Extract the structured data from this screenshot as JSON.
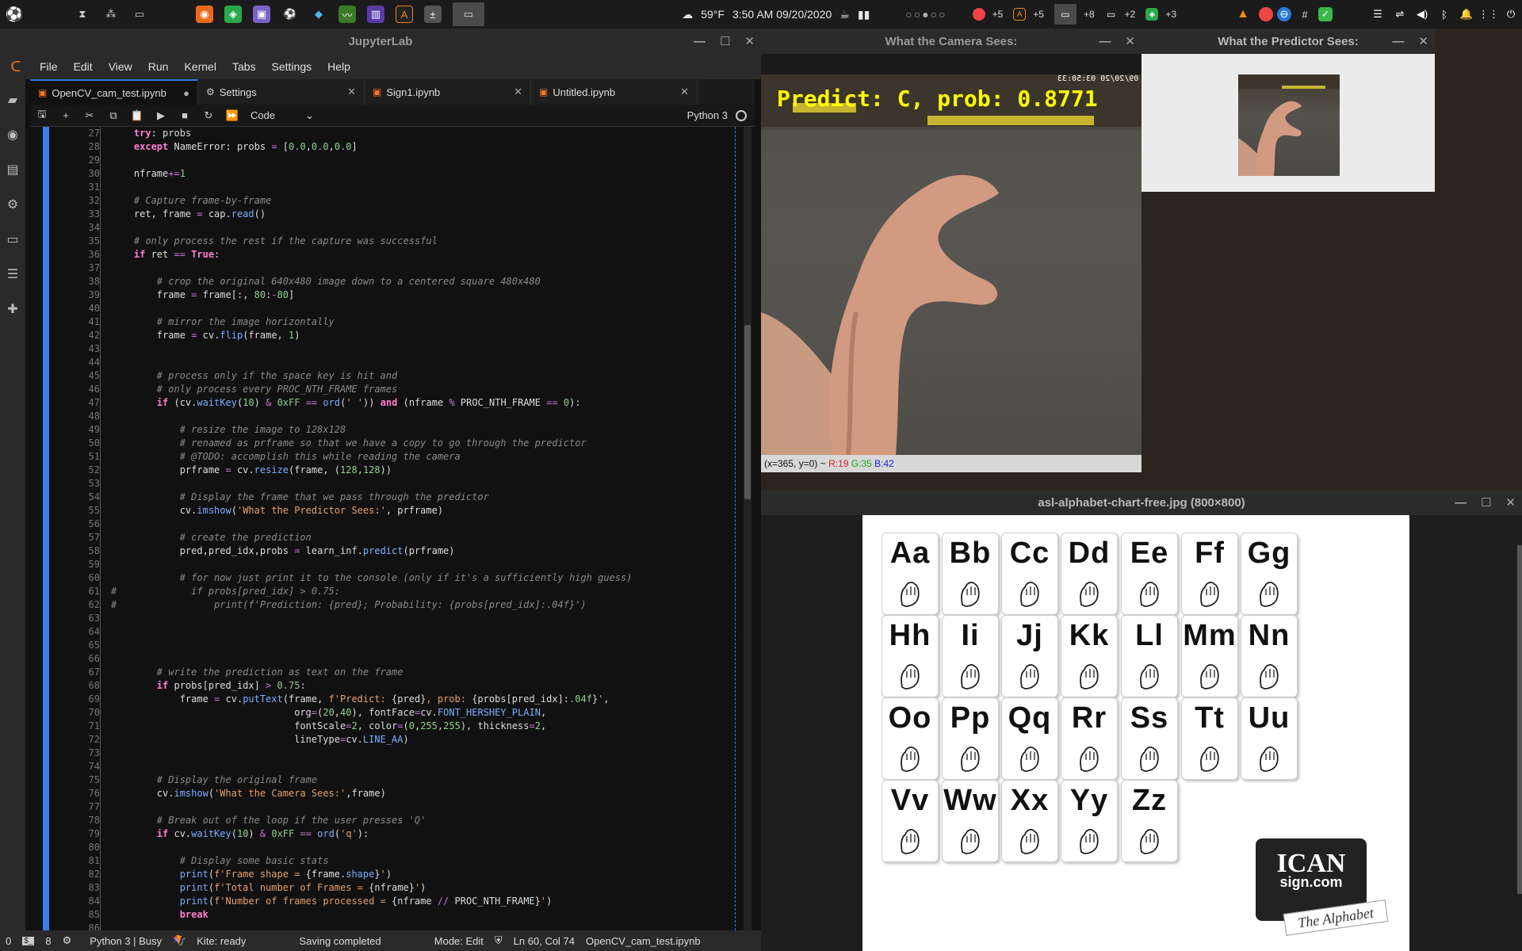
{
  "taskbar": {
    "weather": "59°F",
    "clock": "3:50 AM 09/20/2020",
    "workspaces": "○○●○○",
    "counts": [
      "+5",
      "+5",
      "+8",
      "+2",
      "+3"
    ]
  },
  "jupyter": {
    "title": "JupyterLab",
    "menu": [
      "File",
      "Edit",
      "View",
      "Run",
      "Kernel",
      "Tabs",
      "Settings",
      "Help"
    ],
    "tabs": [
      {
        "label": "OpenCV_cam_test.ipynb"
      },
      {
        "label": "Settings"
      },
      {
        "label": "Sign1.ipynb"
      },
      {
        "label": "Untitled.ipynb"
      }
    ],
    "celltype": "Code",
    "kernel": "Python 3",
    "code_lines": [
      {
        "n": "27",
        "html": "    <span class='t-kw'>try</span>: probs"
      },
      {
        "n": "28",
        "html": "    <span class='t-kw'>except</span> NameError: probs <span class='t-op'>=</span> [<span class='t-nm'>0.0</span>,<span class='t-nm'>0.0</span>,<span class='t-nm'>0.0</span>]"
      },
      {
        "n": "29",
        "html": ""
      },
      {
        "n": "30",
        "html": "    nframe<span class='t-op'>+=</span><span class='t-nm'>1</span>"
      },
      {
        "n": "31",
        "html": ""
      },
      {
        "n": "32",
        "html": "    <span class='t-cm'># Capture frame-by-frame</span>"
      },
      {
        "n": "33",
        "html": "    ret, frame <span class='t-op'>=</span> cap.<span class='t-fn'>read</span>()"
      },
      {
        "n": "34",
        "html": ""
      },
      {
        "n": "35",
        "html": "    <span class='t-cm'># only process the rest if the capture was successful</span>"
      },
      {
        "n": "36",
        "html": "    <span class='t-kw'>if</span> ret <span class='t-op'>==</span> <span class='t-kw'>True</span>:"
      },
      {
        "n": "37",
        "html": ""
      },
      {
        "n": "38",
        "html": "        <span class='t-cm'># crop the original 640x480 image down to a centered square 480x480</span>"
      },
      {
        "n": "39",
        "html": "        frame <span class='t-op'>=</span> frame[:, <span class='t-nm'>80</span>:<span class='t-op'>-</span><span class='t-nm'>80</span>]"
      },
      {
        "n": "40",
        "html": ""
      },
      {
        "n": "41",
        "html": "        <span class='t-cm'># mirror the image horizontally</span>"
      },
      {
        "n": "42",
        "html": "        frame <span class='t-op'>=</span> cv.<span class='t-fn'>flip</span>(frame, <span class='t-nm'>1</span>)"
      },
      {
        "n": "43",
        "html": ""
      },
      {
        "n": "44",
        "html": ""
      },
      {
        "n": "45",
        "html": "        <span class='t-cm'># process only if the space key is hit and</span>"
      },
      {
        "n": "46",
        "html": "        <span class='t-cm'># only process every PROC_NTH_FRAME frames</span>"
      },
      {
        "n": "47",
        "html": "        <span class='t-kw'>if</span> (cv.<span class='t-fn'>waitKey</span>(<span class='t-nm'>10</span>) <span class='t-op'>&amp;</span> <span class='t-nm'>0xFF</span> <span class='t-op'>==</span> <span class='t-fn'>ord</span>(<span class='t-st'>' '</span>)) <span class='t-kw'>and</span> (nframe <span class='t-op'>%</span> PROC_NTH_FRAME <span class='t-op'>==</span> <span class='t-nm'>0</span>):"
      },
      {
        "n": "48",
        "html": ""
      },
      {
        "n": "49",
        "html": "            <span class='t-cm'># resize the image to 128x128</span>"
      },
      {
        "n": "50",
        "html": "            <span class='t-cm'># renamed as prframe so that we have a copy to go through the predictor</span>"
      },
      {
        "n": "51",
        "html": "            <span class='t-cm'># @TODO: accomplish this while reading the camera</span>"
      },
      {
        "n": "52",
        "html": "            prframe <span class='t-op'>=</span> cv.<span class='t-fn'>resize</span>(frame, (<span class='t-nm'>128</span>,<span class='t-nm'>128</span>))"
      },
      {
        "n": "53",
        "html": ""
      },
      {
        "n": "54",
        "html": "            <span class='t-cm'># Display the frame that we pass through the predictor</span>"
      },
      {
        "n": "55",
        "html": "            cv.<span class='t-fn'>imshow</span>(<span class='t-st'>'What the Predictor Sees:'</span>, prframe)"
      },
      {
        "n": "56",
        "html": ""
      },
      {
        "n": "57",
        "html": "            <span class='t-cm'># create the prediction</span>"
      },
      {
        "n": "58",
        "html": "            pred,pred_idx,probs <span class='t-op'>=</span> learn_inf.<span class='t-fn'>predict</span>(prframe)"
      },
      {
        "n": "59",
        "html": ""
      },
      {
        "n": "60",
        "html": "            <span class='t-cm'># for now just print it to the console (only if it's a sufficiently high guess)</span>"
      },
      {
        "n": "61",
        "html": "<span class='t-cm'>#             if probs[pred_idx] &gt; 0.75:</span>"
      },
      {
        "n": "62",
        "html": "<span class='t-cm'>#                 print(f'Prediction: {pred}; Probability: {probs[pred_idx]:.04f}')</span>"
      },
      {
        "n": "63",
        "html": ""
      },
      {
        "n": "64",
        "html": ""
      },
      {
        "n": "65",
        "html": ""
      },
      {
        "n": "66",
        "html": ""
      },
      {
        "n": "67",
        "html": "        <span class='t-cm'># write the prediction as text on the frame</span>"
      },
      {
        "n": "68",
        "html": "        <span class='t-kw'>if</span> probs[pred_idx] <span class='t-op'>&gt;</span> <span class='t-nm'>0.75</span>:"
      },
      {
        "n": "69",
        "html": "            frame <span class='t-op'>=</span> cv.<span class='t-fn'>putText</span>(frame, <span class='t-st'>f'Predict: </span>{pred}<span class='t-st'>, prob: </span>{probs[pred_idx]:<span class='t-nm'>.04f</span>}<span class='t-st'>'</span>,"
      },
      {
        "n": "70",
        "html": "                                org<span class='t-op'>=</span>(<span class='t-nm'>20</span>,<span class='t-nm'>40</span>), fontFace<span class='t-op'>=</span>cv.<span class='t-fn'>FONT_HERSHEY_PLAIN</span>,"
      },
      {
        "n": "71",
        "html": "                                fontScale<span class='t-op'>=</span><span class='t-nm'>2</span>, color<span class='t-op'>=</span>(<span class='t-nm'>0</span>,<span class='t-nm'>255</span>,<span class='t-nm'>255</span>), thickness<span class='t-op'>=</span><span class='t-nm'>2</span>,"
      },
      {
        "n": "72",
        "html": "                                lineType<span class='t-op'>=</span>cv.<span class='t-fn'>LINE_AA</span>)"
      },
      {
        "n": "73",
        "html": ""
      },
      {
        "n": "74",
        "html": ""
      },
      {
        "n": "75",
        "html": "        <span class='t-cm'># Display the original frame</span>"
      },
      {
        "n": "76",
        "html": "        cv.<span class='t-fn'>imshow</span>(<span class='t-st'>'What the Camera Sees:'</span>,frame)"
      },
      {
        "n": "77",
        "html": ""
      },
      {
        "n": "78",
        "html": "        <span class='t-cm'># Break out of the loop if the user presses 'Q'</span>"
      },
      {
        "n": "79",
        "html": "        <span class='t-kw'>if</span> cv.<span class='t-fn'>waitKey</span>(<span class='t-nm'>10</span>) <span class='t-op'>&amp;</span> <span class='t-nm'>0xFF</span> <span class='t-op'>==</span> <span class='t-fn'>ord</span>(<span class='t-st'>'q'</span>):"
      },
      {
        "n": "80",
        "html": ""
      },
      {
        "n": "81",
        "html": "            <span class='t-cm'># Display some basic stats</span>"
      },
      {
        "n": "82",
        "html": "            <span class='t-fn'>print</span>(<span class='t-st'>f'Frame shape = </span>{frame.<span class='t-fn'>shape</span>}<span class='t-st'>'</span>)"
      },
      {
        "n": "83",
        "html": "            <span class='t-fn'>print</span>(<span class='t-st'>f'Total number of Frames = </span>{nframe}<span class='t-st'>'</span>)"
      },
      {
        "n": "84",
        "html": "            <span class='t-fn'>print</span>(<span class='t-st'>f'Number of frames processed = </span>{nframe <span class='t-op'>//</span> PROC_NTH_FRAME}<span class='t-st'>'</span>)"
      },
      {
        "n": "85",
        "html": "            <span class='t-kw'>break</span>"
      },
      {
        "n": "86",
        "html": ""
      }
    ],
    "status": {
      "left_num": "0",
      "term_num": "8",
      "kernel_state": "Python 3 | Busy",
      "kite": "Kite: ready",
      "saving": "Saving completed",
      "mode": "Mode: Edit",
      "position": "Ln 60, Col 74",
      "file": "OpenCV_cam_test.ipynb"
    }
  },
  "camera_window": {
    "title": "What the Camera Sees:",
    "prediction_text": "Predict: C, prob: 0.8771",
    "stamp": "09/20/20 03:50:33",
    "status": {
      "coords": "(x=365, y=0) ~",
      "r": "R:19",
      "g": "G:35",
      "b": "B:42"
    }
  },
  "predictor_window": {
    "title": "What the Predictor Sees:"
  },
  "image_viewer": {
    "title": "asl-alphabet-chart-free.jpg (800×800)",
    "cards": [
      "Aa",
      "Bb",
      "Cc",
      "Dd",
      "Ee",
      "Ff",
      "Gg",
      "Hh",
      "Ii",
      "Jj",
      "Kk",
      "Ll",
      "Mm",
      "Nn",
      "Oo",
      "Pp",
      "Qq",
      "Rr",
      "Ss",
      "Tt",
      "Uu",
      "Vv",
      "Ww",
      "Xx",
      "Yy",
      "Zz"
    ],
    "logo": {
      "big": "ICAN",
      "small": "sign.com",
      "tag": "The Alphabet"
    }
  }
}
